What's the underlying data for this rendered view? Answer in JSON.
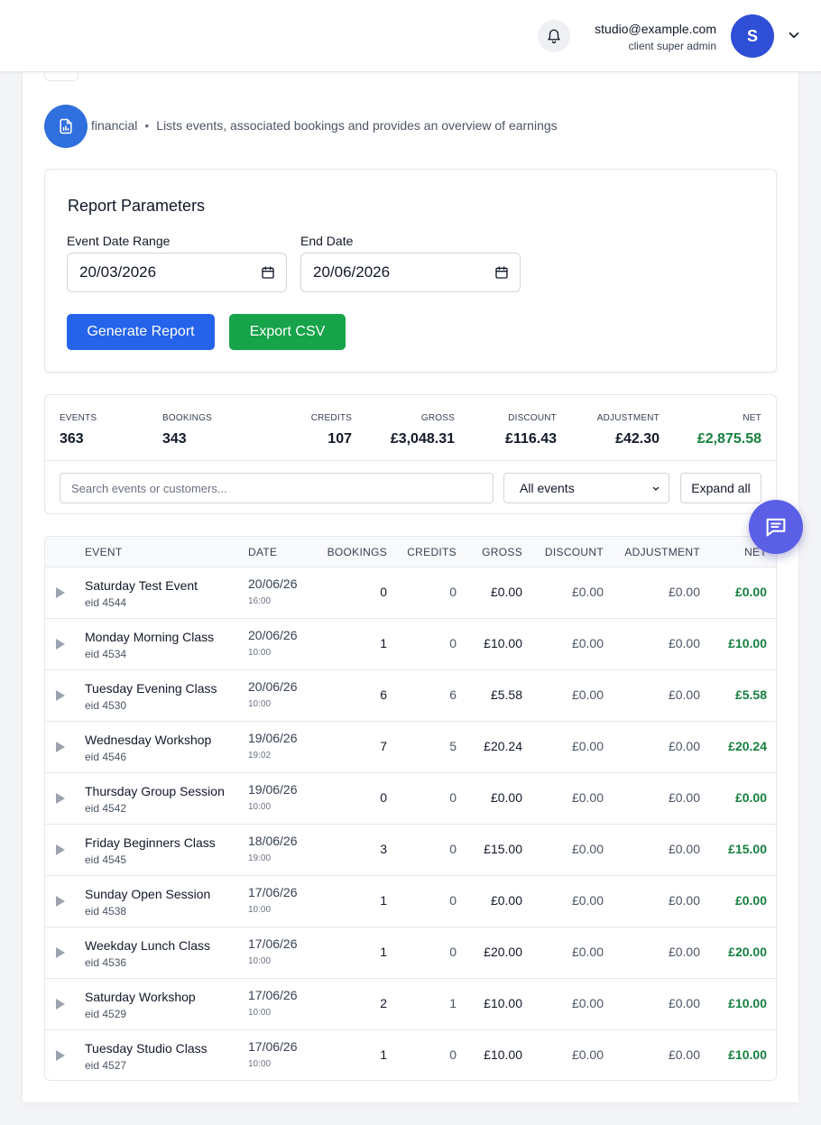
{
  "header": {
    "user_email": "studio@example.com",
    "user_role": "client super admin",
    "avatar_initial": "S"
  },
  "report": {
    "type": "financial",
    "description": "Lists events, associated bookings and provides an overview of earnings"
  },
  "params": {
    "title": "Report Parameters",
    "start_label": "Event Date Range",
    "start_value": "20/03/2026",
    "end_label": "End Date",
    "end_value": "20/06/2026",
    "generate_label": "Generate Report",
    "export_label": "Export CSV"
  },
  "summary": {
    "events_label": "EVENTS",
    "events_value": "363",
    "bookings_label": "BOOKINGS",
    "bookings_value": "343",
    "credits_label": "CREDITS",
    "credits_value": "107",
    "gross_label": "GROSS",
    "gross_value": "£3,048.31",
    "discount_label": "DISCOUNT",
    "discount_value": "£116.43",
    "adjustment_label": "ADJUSTMENT",
    "adjustment_value": "£42.30",
    "net_label": "NET",
    "net_value": "£2,875.58"
  },
  "filters": {
    "search_placeholder": "Search events or customers...",
    "select_value": "All events",
    "expand_label": "Expand all"
  },
  "table": {
    "headers": {
      "event": "EVENT",
      "date": "DATE",
      "bookings": "BOOKINGS",
      "credits": "CREDITS",
      "gross": "GROSS",
      "discount": "DISCOUNT",
      "adjustment": "ADJUSTMENT",
      "net": "NET"
    },
    "rows": [
      {
        "name": "Saturday Test Event",
        "eid": "eid 4544",
        "date": "20/06/26",
        "time": "16:00",
        "bookings": "0",
        "credits": "0",
        "gross": "£0.00",
        "discount": "£0.00",
        "adjustment": "£0.00",
        "net": "£0.00"
      },
      {
        "name": "Monday Morning Class",
        "eid": "eid 4534",
        "date": "20/06/26",
        "time": "10:00",
        "bookings": "1",
        "credits": "0",
        "gross": "£10.00",
        "discount": "£0.00",
        "adjustment": "£0.00",
        "net": "£10.00"
      },
      {
        "name": "Tuesday Evening Class",
        "eid": "eid 4530",
        "date": "20/06/26",
        "time": "10:00",
        "bookings": "6",
        "credits": "6",
        "gross": "£5.58",
        "discount": "£0.00",
        "adjustment": "£0.00",
        "net": "£5.58"
      },
      {
        "name": "Wednesday Workshop",
        "eid": "eid 4546",
        "date": "19/06/26",
        "time": "19:02",
        "bookings": "7",
        "credits": "5",
        "gross": "£20.24",
        "discount": "£0.00",
        "adjustment": "£0.00",
        "net": "£20.24"
      },
      {
        "name": "Thursday Group Session",
        "eid": "eid 4542",
        "date": "19/06/26",
        "time": "10:00",
        "bookings": "0",
        "credits": "0",
        "gross": "£0.00",
        "discount": "£0.00",
        "adjustment": "£0.00",
        "net": "£0.00"
      },
      {
        "name": "Friday Beginners Class",
        "eid": "eid 4545",
        "date": "18/06/26",
        "time": "19:00",
        "bookings": "3",
        "credits": "0",
        "gross": "£15.00",
        "discount": "£0.00",
        "adjustment": "£0.00",
        "net": "£15.00"
      },
      {
        "name": "Sunday Open Session",
        "eid": "eid 4538",
        "date": "17/06/26",
        "time": "10:00",
        "bookings": "1",
        "credits": "0",
        "gross": "£0.00",
        "discount": "£0.00",
        "adjustment": "£0.00",
        "net": "£0.00"
      },
      {
        "name": "Weekday Lunch Class",
        "eid": "eid 4536",
        "date": "17/06/26",
        "time": "10:00",
        "bookings": "1",
        "credits": "0",
        "gross": "£20.00",
        "discount": "£0.00",
        "adjustment": "£0.00",
        "net": "£20.00"
      },
      {
        "name": "Saturday Workshop",
        "eid": "eid 4529",
        "date": "17/06/26",
        "time": "10:00",
        "bookings": "2",
        "credits": "1",
        "gross": "£10.00",
        "discount": "£0.00",
        "adjustment": "£0.00",
        "net": "£10.00"
      },
      {
        "name": "Tuesday Studio Class",
        "eid": "eid 4527",
        "date": "17/06/26",
        "time": "10:00",
        "bookings": "1",
        "credits": "0",
        "gross": "£10.00",
        "discount": "£0.00",
        "adjustment": "£0.00",
        "net": "£10.00"
      }
    ]
  },
  "icons": {
    "bell": "bell-icon",
    "chevron": "chevron-down-icon",
    "report": "report-icon",
    "calendar": "calendar-icon",
    "expand_row": "triangle-right-icon",
    "chat": "chat-icon"
  },
  "colors": {
    "primary": "#2563eb",
    "success": "#16a34a",
    "net_text": "#15803d",
    "avatar": "#2f4fd6",
    "chat": "#5b5fe6"
  }
}
